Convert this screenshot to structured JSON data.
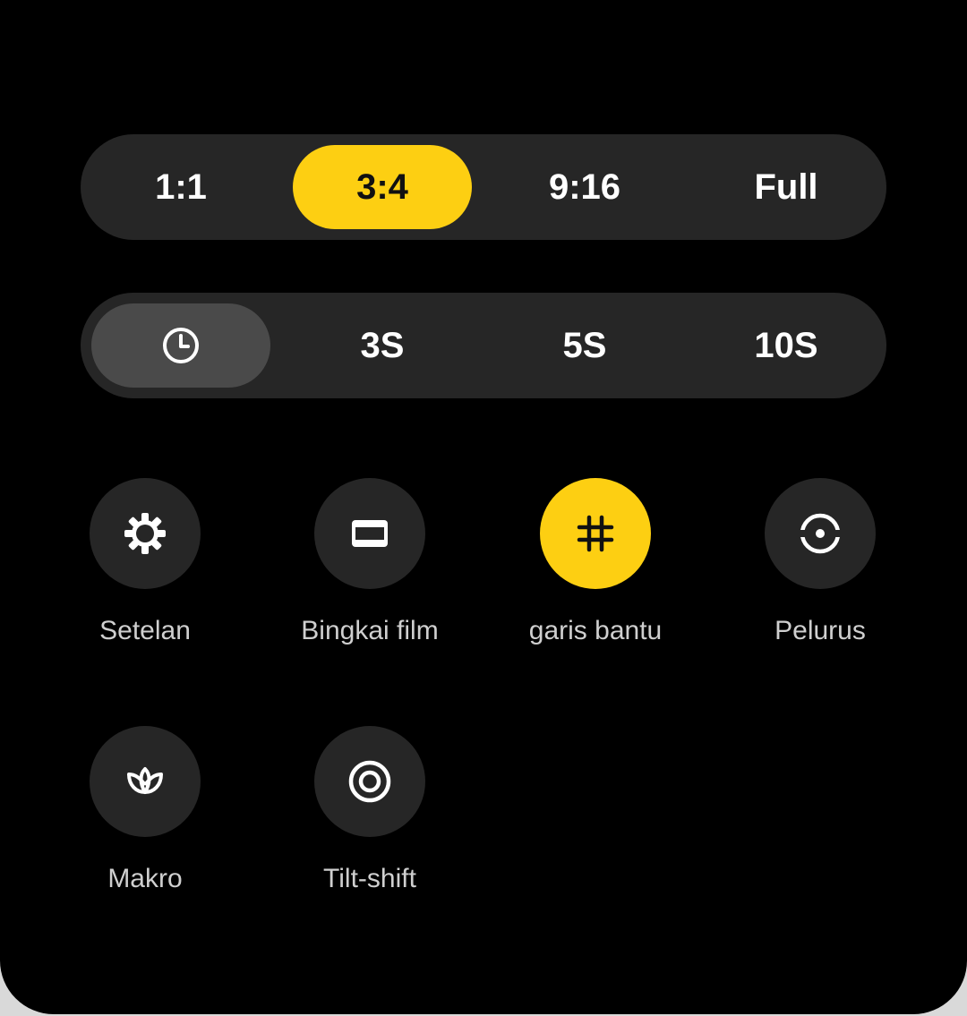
{
  "aspect_ratio": {
    "options": [
      "1:1",
      "3:4",
      "9:16",
      "Full"
    ],
    "selected": "3:4"
  },
  "timer": {
    "off_icon": "clock-icon",
    "options": [
      "3S",
      "5S",
      "10S"
    ],
    "selected": "off"
  },
  "tools": [
    {
      "label": "Setelan",
      "icon": "gear-icon",
      "active": false
    },
    {
      "label": "Bingkai film",
      "icon": "film-frame-icon",
      "active": false
    },
    {
      "label": "garis bantu",
      "icon": "grid-icon",
      "active": true
    },
    {
      "label": "Pelurus",
      "icon": "level-icon",
      "active": false
    },
    {
      "label": "Makro",
      "icon": "macro-flower-icon",
      "active": false
    },
    {
      "label": "Tilt-shift",
      "icon": "tilt-shift-icon",
      "active": false
    }
  ],
  "colors": {
    "accent": "#fdcf12",
    "panel_background": "#000000",
    "control_background": "#262626",
    "selected_grey": "#4a4a4a",
    "label_text": "#cfcfcf"
  }
}
